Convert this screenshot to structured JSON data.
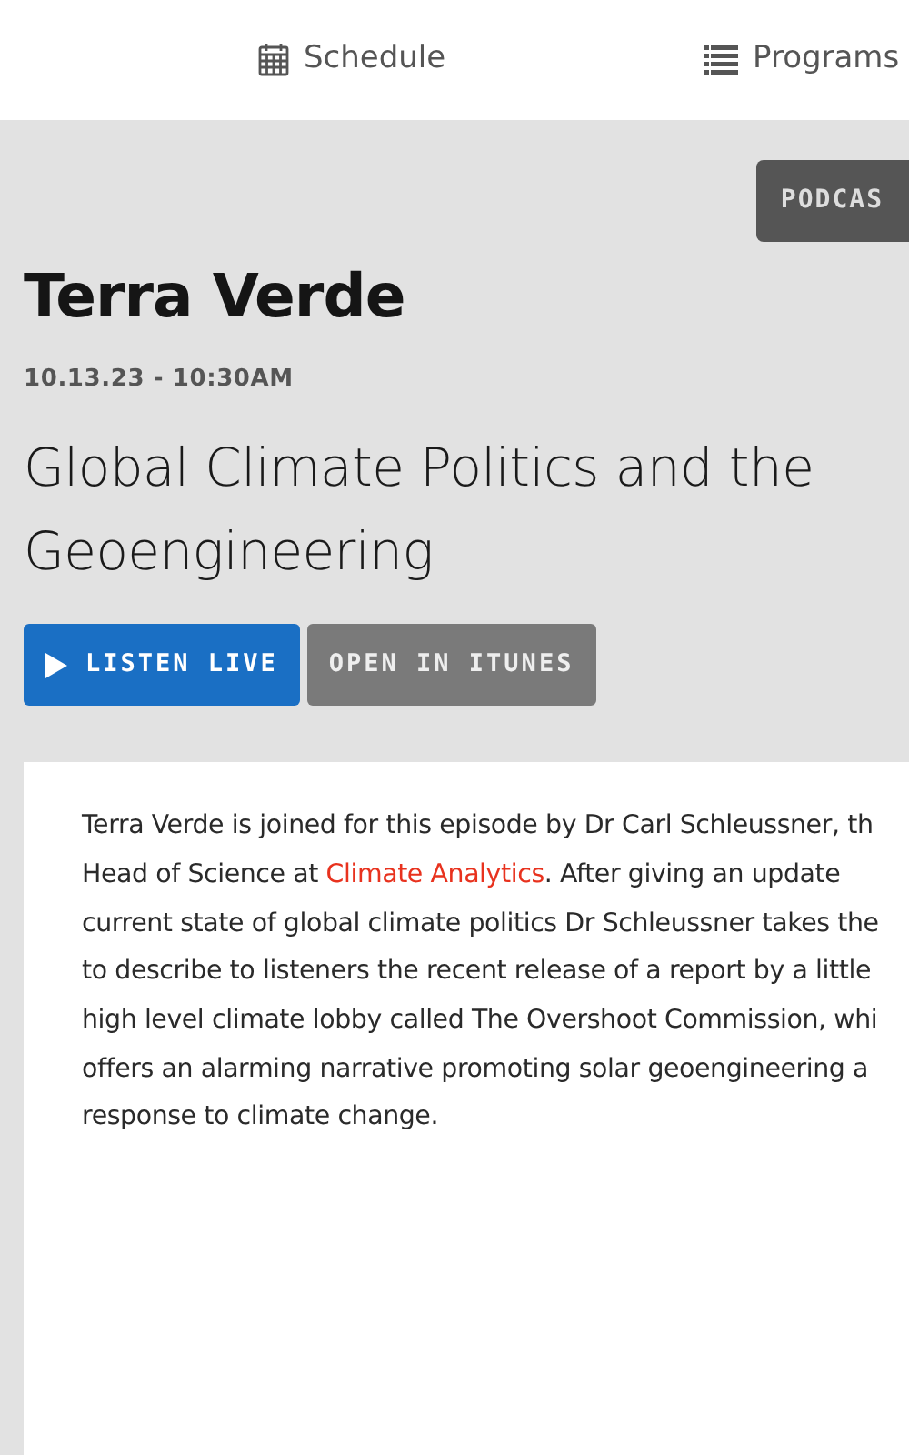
{
  "nav": [
    {
      "kind": "calendar",
      "label": "Schedule"
    },
    {
      "kind": "list",
      "label": "Programs"
    }
  ],
  "podcast_button": "PODCAS",
  "program": "Terra Verde",
  "date": "10.13.23 - 10:30AM",
  "episode_title": [
    "Global Climate Politics and the",
    "Geoengineering"
  ],
  "buttons": [
    {
      "kind": "listen",
      "label": "LISTEN LIVE"
    },
    {
      "kind": "itunes",
      "label": "OPEN IN ITUNES"
    }
  ],
  "description": [
    [
      {
        "kind": "text",
        "text": "Terra Verde is joined for this episode by Dr Carl Schleussner, th"
      }
    ],
    [
      {
        "kind": "text",
        "text": "Head of Science at "
      },
      {
        "kind": "link",
        "text": "Climate Analytics"
      },
      {
        "kind": "text",
        "text": ". After giving an update"
      }
    ],
    [
      {
        "kind": "text",
        "text": "current state of global climate politics Dr Schleussner takes the"
      }
    ],
    [
      {
        "kind": "text",
        "text": "to describe to listeners the recent release of a report by a little"
      }
    ],
    [
      {
        "kind": "text",
        "text": "high level climate lobby called The Overshoot Commission, whi"
      }
    ],
    [
      {
        "kind": "text",
        "text": "offers an alarming narrative promoting solar geoengineering a"
      }
    ],
    [
      {
        "kind": "text",
        "text": "response to climate change."
      }
    ]
  ]
}
